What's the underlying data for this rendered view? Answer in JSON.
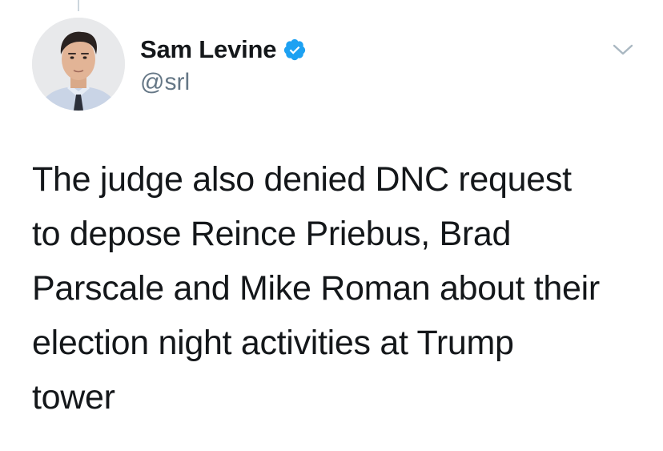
{
  "author": {
    "display_name": "Sam Levine",
    "handle": "@srl",
    "verified": true
  },
  "tweet": {
    "text": "The judge also denied DNC request\nto depose Reince Priebus, Brad\nParscale and Mike Roman about their\nelection night activities at Trump\ntower"
  },
  "icons": {
    "verified": "verified-check-icon",
    "menu": "chevron-down-icon"
  },
  "colors": {
    "verified_blue": "#1da1f2",
    "secondary_text": "#657786",
    "primary_text": "#14171a",
    "caret": "#aab8c2"
  }
}
